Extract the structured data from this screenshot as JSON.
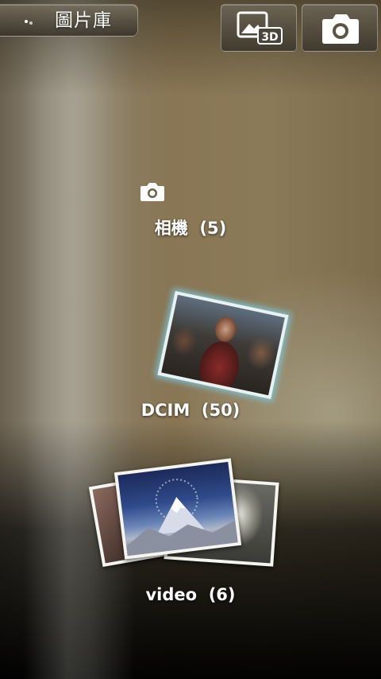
{
  "topbar": {
    "title": "圖片庫",
    "buttons": [
      {
        "name": "3d-gallery-button",
        "icon": "image-3d-icon",
        "badge": "3D"
      },
      {
        "name": "camera-button",
        "icon": "camera-icon"
      }
    ]
  },
  "albums": [
    {
      "name": "相機",
      "count": "(5)",
      "label": "相機  (5)",
      "icon": "camera-icon"
    },
    {
      "name": "DCIM",
      "count": "(50)",
      "label": "DCIM  (50)"
    },
    {
      "name": "video",
      "count": "(6)",
      "label": "video  (6)"
    }
  ]
}
